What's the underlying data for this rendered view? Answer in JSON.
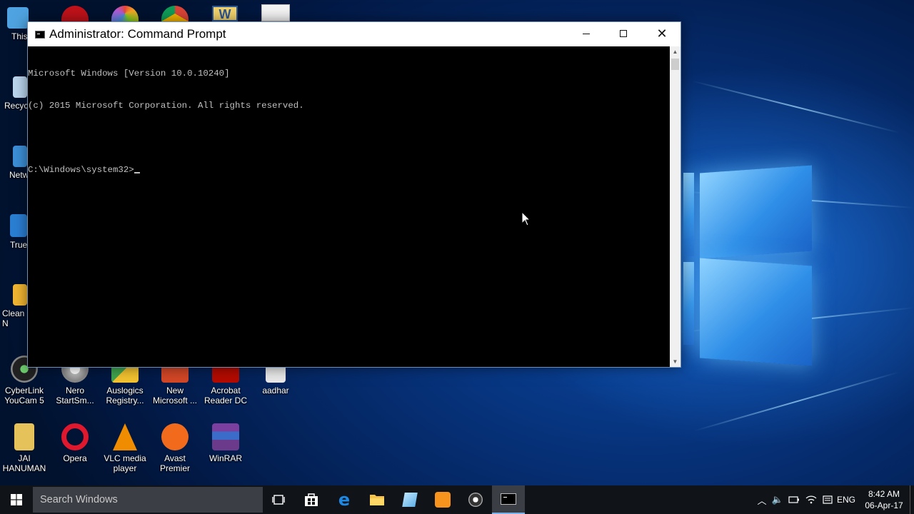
{
  "desktop": {
    "icons": [
      {
        "label": "This",
        "icon": "this-pc-icon",
        "color": "#4fa3e0"
      },
      {
        "label": "Recycl",
        "icon": "recycle-bin-icon",
        "color": "#bcd7ef"
      },
      {
        "label": "Netw",
        "icon": "network-icon",
        "color": "#3c8fd8"
      },
      {
        "label": "True",
        "icon": "true-key-icon",
        "color": "#2a7fd4"
      },
      {
        "label": "Clean N",
        "icon": "clean-master-icon",
        "color": "#f2b632"
      },
      {
        "label": "CyberLink\nYouCam 5",
        "icon": "youcam-icon",
        "color": "#333333"
      },
      {
        "label": "Nero\nStartSm...",
        "icon": "nero-icon",
        "color": "#d0d0d0"
      },
      {
        "label": "Auslogics\nRegistry...",
        "icon": "auslogics-icon",
        "color": "#3fa34d"
      },
      {
        "label": "New\nMicrosoft ...",
        "icon": "powerpoint-icon",
        "color": "#d24726"
      },
      {
        "label": "Acrobat\nReader DC",
        "icon": "acrobat-icon",
        "color": "#b30b00"
      },
      {
        "label": "aadhar",
        "icon": "document-icon",
        "color": "#e8e8e8"
      },
      {
        "label": "JAI\nHANUMAN",
        "icon": "folder-icon",
        "color": "#e6c25a"
      },
      {
        "label": "Opera",
        "icon": "opera-icon",
        "color": "#e0182d"
      },
      {
        "label": "VLC media\nplayer",
        "icon": "vlc-icon",
        "color": "#f08c00"
      },
      {
        "label": "Avast\nPremier",
        "icon": "avast-icon",
        "color": "#f26b1d"
      },
      {
        "label": "WinRAR",
        "icon": "winrar-icon",
        "color": "#7b3fa0"
      }
    ],
    "top_icons": [
      {
        "icon": "app-red-icon",
        "color": "#c0121a"
      },
      {
        "icon": "picasa-icon",
        "color": "#b05bd8"
      },
      {
        "icon": "chrome-icon",
        "color": "#3aa757"
      },
      {
        "icon": "word-icon",
        "color": "#2b5797"
      },
      {
        "icon": "doc-thumbnail-icon",
        "color": "#f4f4f4"
      }
    ]
  },
  "window": {
    "title": "Administrator: Command Prompt",
    "console_lines": [
      "Microsoft Windows [Version 10.0.10240]",
      "(c) 2015 Microsoft Corporation. All rights reserved.",
      "",
      "C:\\Windows\\system32>"
    ],
    "controls": {
      "minimize": "minimize-icon",
      "maximize": "maximize-icon",
      "close": "close-icon"
    }
  },
  "taskbar": {
    "search_placeholder": "Search Windows",
    "apps": [
      {
        "icon": "task-view-icon"
      },
      {
        "icon": "store-icon"
      },
      {
        "icon": "edge-icon"
      },
      {
        "icon": "file-explorer-icon"
      },
      {
        "icon": "notepad-icon"
      },
      {
        "icon": "uc-browser-icon"
      },
      {
        "icon": "youcam-icon"
      },
      {
        "icon": "command-prompt-icon",
        "active": true
      }
    ],
    "tray": {
      "language": "ENG",
      "time": "8:42 AM",
      "date": "06-Apr-17"
    }
  }
}
